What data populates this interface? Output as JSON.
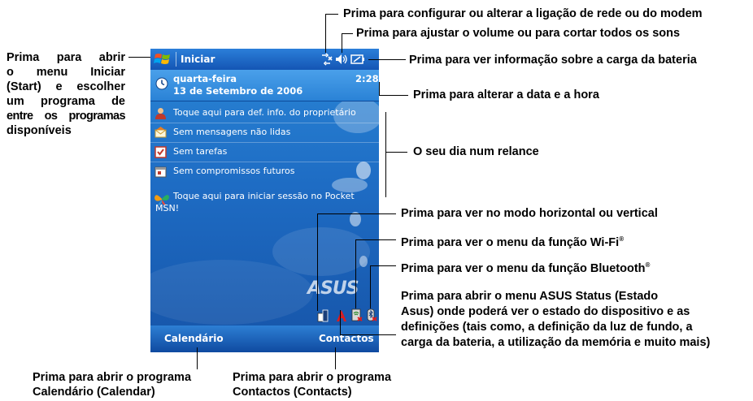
{
  "device": {
    "start_label": "Iniciar",
    "time": "2:28",
    "day": "quarta-feira",
    "date": "13 de Setembro de 2006",
    "today_items": [
      {
        "label": "Toque aqui para def. info. do proprietário",
        "icon": "owner-icon"
      },
      {
        "label": "Sem mensagens não lidas",
        "icon": "messages-icon"
      },
      {
        "label": "Sem tarefas",
        "icon": "tasks-icon"
      },
      {
        "label": "Sem compromissos futuros",
        "icon": "calendar-icon"
      }
    ],
    "msn_line1": "Toque aqui para iniciar sessão no Pocket",
    "msn_line2": "MSN!",
    "brand": "ASUS",
    "softkey_left": "Calendário",
    "softkey_right": "Contactos"
  },
  "callouts": {
    "start_menu": [
      "Prima para abrir",
      "o menu Iniciar",
      "(Start) e escolher",
      "um programa de",
      "entre os programas",
      "disponíveis"
    ],
    "network": "Prima para configurar ou alterar a ligação de rede ou do modem",
    "volume": "Prima para ajustar o volume ou para cortar todos os sons",
    "battery": "Prima para ver informação sobre a carga da bateria",
    "datetime": "Prima para alterar a data e a hora",
    "glance": "O seu dia num relance",
    "orientation": "Prima para ver no modo horizontal ou vertical",
    "wifi": "Prima para ver o menu da função Wi-Fi",
    "bluetooth": "Prima para ver o menu da função Bluetooth",
    "registered_mark": "®",
    "asus_status": [
      "Prima para abrir o menu ASUS Status (Estado",
      "Asus) onde poderá ver o estado do dispositivo e as",
      "definições (tais como, a definição da luz de fundo, a",
      "carga da bateria, a utilização da memória e muito mais)"
    ],
    "calendar": [
      "Prima para abrir o programa",
      "Calendário (Calendar)"
    ],
    "contacts": [
      "Prima para abrir o programa",
      "Contactos (Contacts)"
    ]
  },
  "colors": {
    "screen_blue": "#1e6cc4",
    "title_blue": "#1455b4"
  }
}
